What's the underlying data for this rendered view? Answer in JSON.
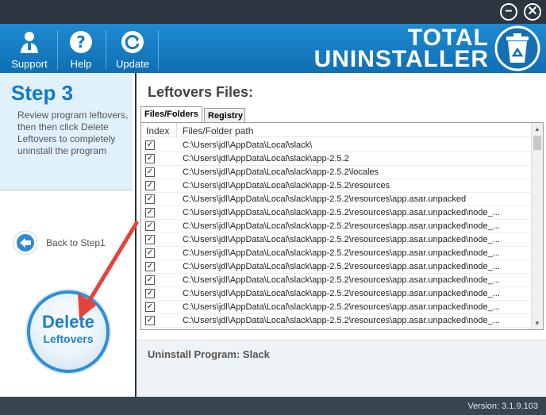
{
  "window": {
    "minimize_glyph": "−",
    "close_glyph": "✕"
  },
  "toolbar": {
    "support_label": "Support",
    "help_label": "Help",
    "update_label": "Update"
  },
  "brand": {
    "line1": "TOTAL",
    "line2": "UNINSTALLER"
  },
  "sidebar": {
    "step_title": "Step 3",
    "step_description": "Review program leftovers, then then click Delete Leftovers to completely uninstall the program",
    "back_label": "Back to Step1",
    "delete_line1": "Delete",
    "delete_line2": "Leftovers"
  },
  "main": {
    "title": "Leftovers Files:",
    "tabs": [
      {
        "label": "Files/Folders",
        "active": true
      },
      {
        "label": "Registry",
        "active": false
      }
    ],
    "columns": {
      "index": "Index",
      "path": "Files/Folder path"
    },
    "rows": [
      {
        "checked": true,
        "path": "C:\\Users\\jdl\\AppData\\Local\\slack\\"
      },
      {
        "checked": true,
        "path": "C:\\Users\\jdl\\AppData\\Local\\slack\\app-2.5.2"
      },
      {
        "checked": true,
        "path": "C:\\Users\\jdl\\AppData\\Local\\slack\\app-2.5.2\\locales"
      },
      {
        "checked": true,
        "path": "C:\\Users\\jdl\\AppData\\Local\\slack\\app-2.5.2\\resources"
      },
      {
        "checked": true,
        "path": "C:\\Users\\jdl\\AppData\\Local\\slack\\app-2.5.2\\resources\\app.asar.unpacked"
      },
      {
        "checked": true,
        "path": "C:\\Users\\jdl\\AppData\\Local\\slack\\app-2.5.2\\resources\\app.asar.unpacked\\node_..."
      },
      {
        "checked": true,
        "path": "C:\\Users\\jdl\\AppData\\Local\\slack\\app-2.5.2\\resources\\app.asar.unpacked\\node_..."
      },
      {
        "checked": true,
        "path": "C:\\Users\\jdl\\AppData\\Local\\slack\\app-2.5.2\\resources\\app.asar.unpacked\\node_..."
      },
      {
        "checked": true,
        "path": "C:\\Users\\jdl\\AppData\\Local\\slack\\app-2.5.2\\resources\\app.asar.unpacked\\node_..."
      },
      {
        "checked": true,
        "path": "C:\\Users\\jdl\\AppData\\Local\\slack\\app-2.5.2\\resources\\app.asar.unpacked\\node_..."
      },
      {
        "checked": true,
        "path": "C:\\Users\\jdl\\AppData\\Local\\slack\\app-2.5.2\\resources\\app.asar.unpacked\\node_..."
      },
      {
        "checked": true,
        "path": "C:\\Users\\jdl\\AppData\\Local\\slack\\app-2.5.2\\resources\\app.asar.unpacked\\node_..."
      },
      {
        "checked": true,
        "path": "C:\\Users\\jdl\\AppData\\Local\\slack\\app-2.5.2\\resources\\app.asar.unpacked\\node_..."
      },
      {
        "checked": true,
        "path": "C:\\Users\\jdl\\AppData\\Local\\slack\\app-2.5.2\\resources\\app.asar.unpacked\\node_..."
      }
    ],
    "uninstall_program": "Uninstall Program:  Slack"
  },
  "footer": {
    "version": "Version: 3.1.9.103"
  },
  "colors": {
    "header_blue": "#1e8bd1",
    "step_blue": "#1378c6",
    "arrow_red": "#e8413a"
  }
}
